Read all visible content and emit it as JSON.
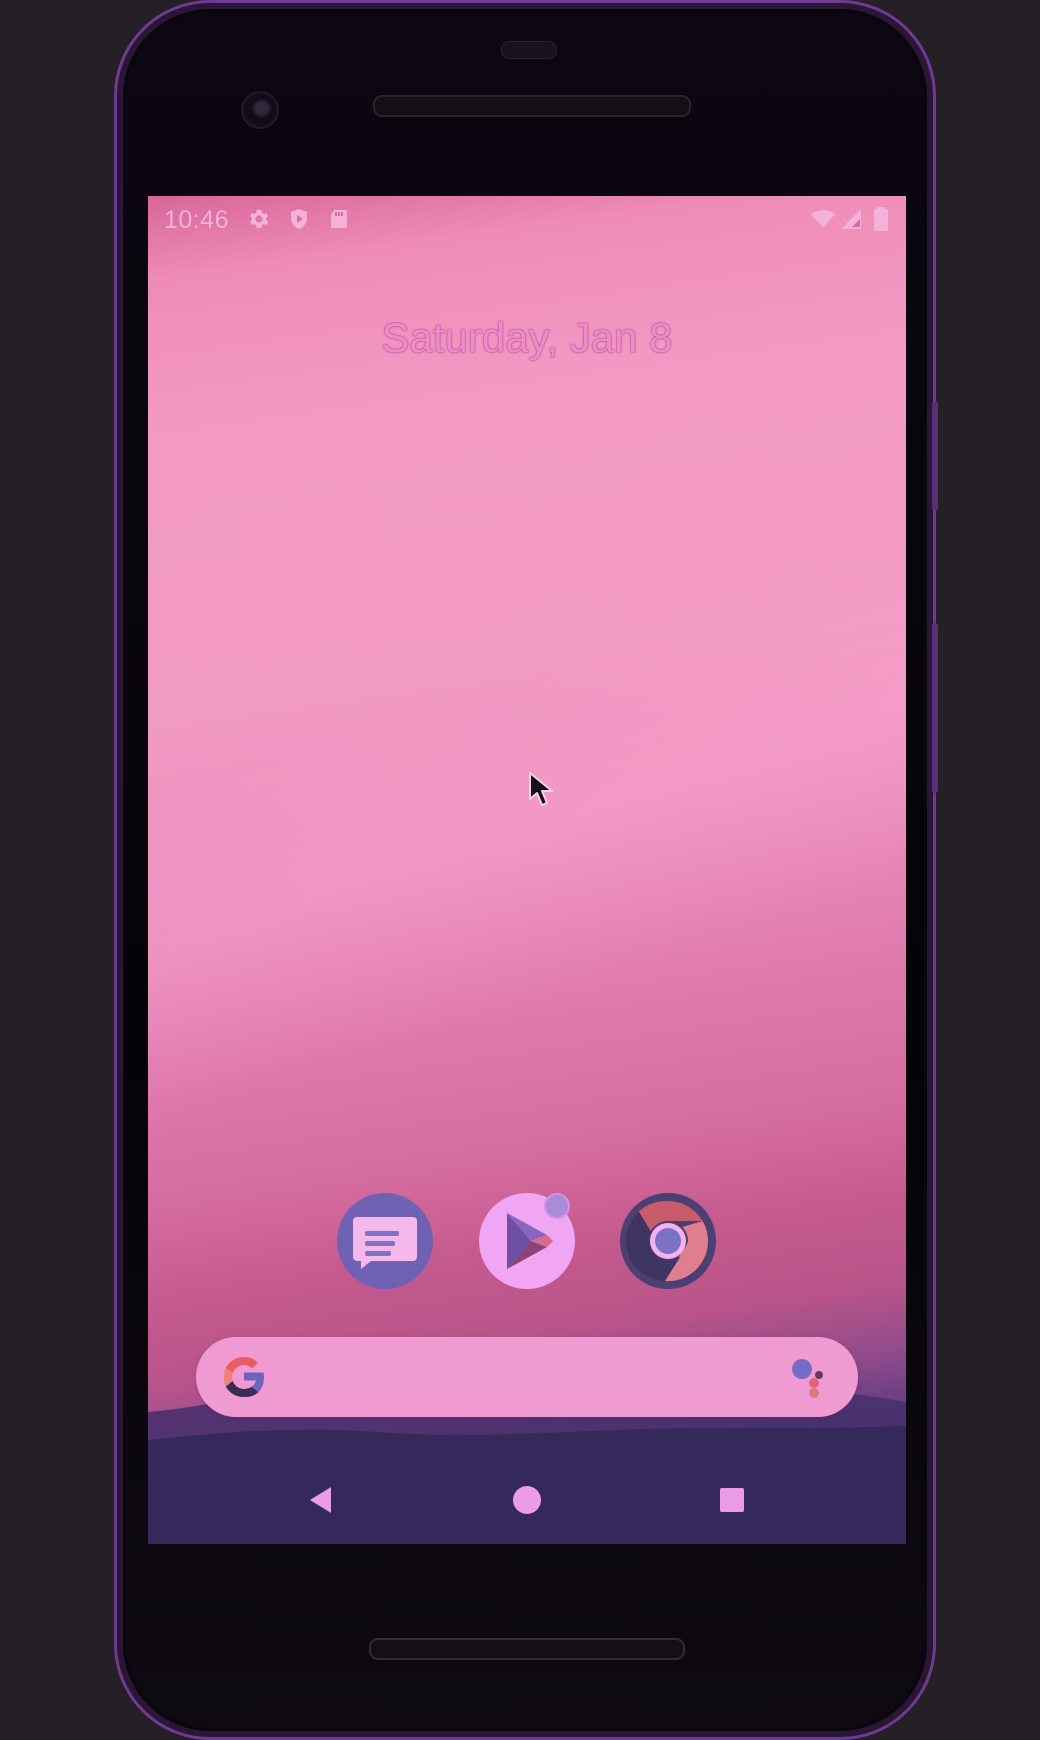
{
  "status_bar": {
    "time": "10:46",
    "left_icons": [
      "settings-icon",
      "shield-play-icon",
      "sd-card-icon"
    ],
    "right_icons": [
      "wifi-icon",
      "signal-icon",
      "battery-icon"
    ]
  },
  "home_screen": {
    "date": "Saturday, Jan 8"
  },
  "dock": {
    "apps": [
      {
        "name": "messages",
        "icon": "messages-icon"
      },
      {
        "name": "play-store",
        "icon": "play-store-icon",
        "badge": true
      },
      {
        "name": "chrome",
        "icon": "chrome-icon"
      }
    ]
  },
  "search": {
    "value": "",
    "placeholder": "",
    "google_icon": "google-g-icon",
    "assistant_icon": "assistant-dots-icon"
  },
  "navigation": {
    "buttons": [
      "back-icon",
      "home-icon",
      "recents-icon"
    ]
  },
  "colors": {
    "wallpaper_pink": "#f19ac3",
    "wallpaper_dusk": "#3b2d5c",
    "status_text": "#f4b2d8",
    "date_text": "#f08ac8",
    "search_bar": "#f09ad2",
    "device_accent": "#6f3a90"
  }
}
